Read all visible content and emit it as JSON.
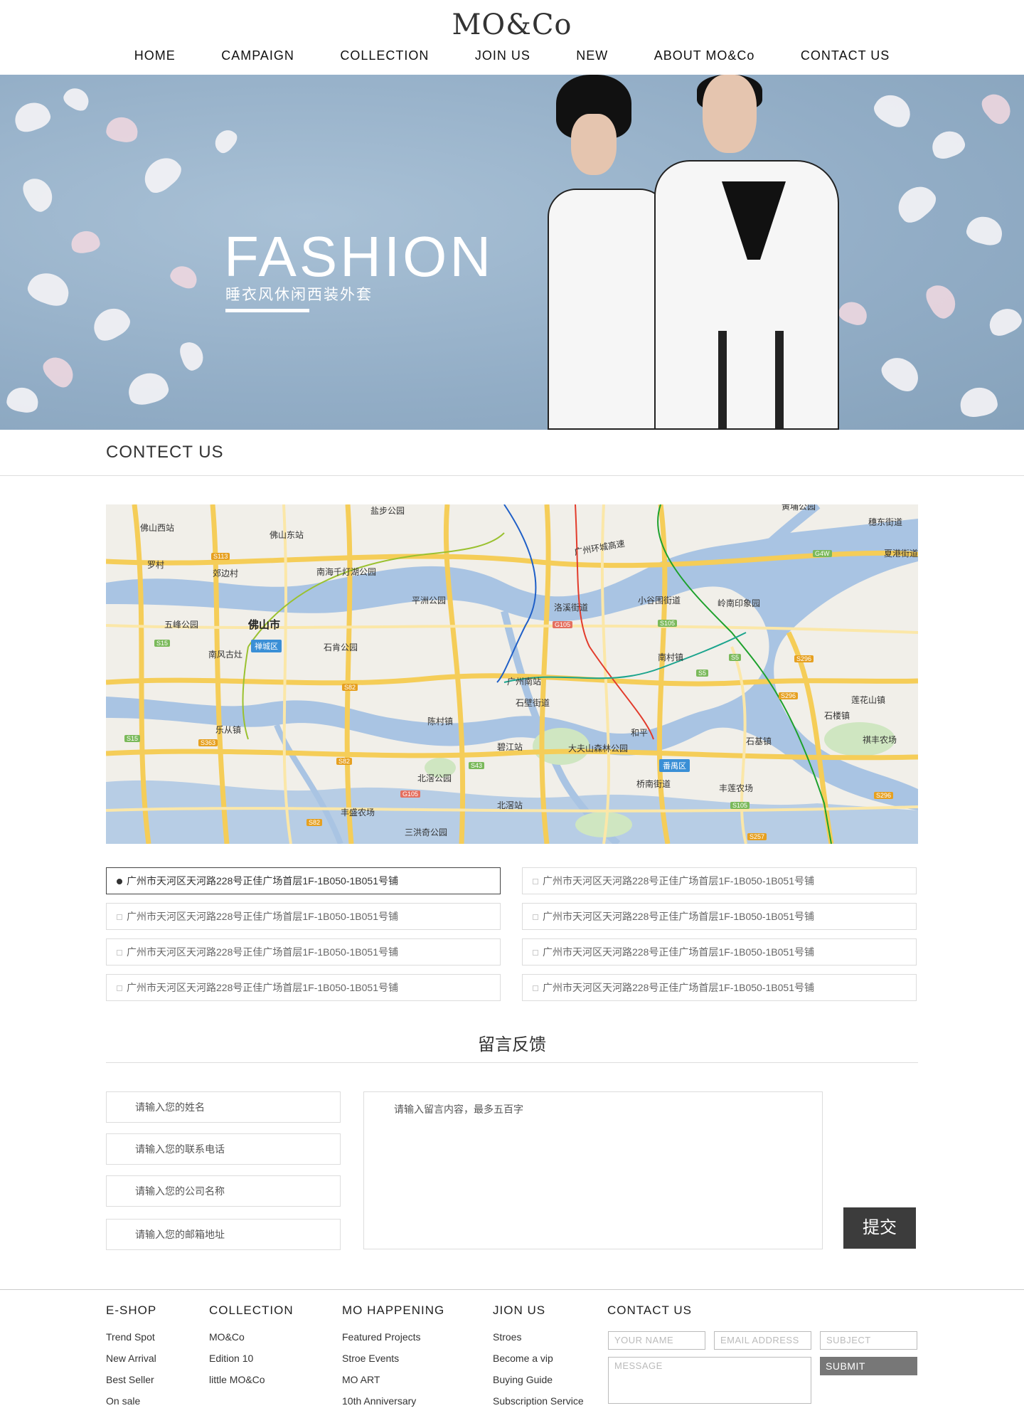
{
  "brand": {
    "logo": "MO&Co"
  },
  "nav": [
    {
      "label": "HOME"
    },
    {
      "label": "CAMPAIGN"
    },
    {
      "label": "COLLECTION"
    },
    {
      "label": "JOIN US"
    },
    {
      "label": "NEW"
    },
    {
      "label": "ABOUT MO&Co"
    },
    {
      "label": "CONTACT US"
    }
  ],
  "banner": {
    "title": "FASHION",
    "subtitle": "睡衣风休闲西装外套"
  },
  "contact_section": {
    "title": "CONTECT US"
  },
  "map": {
    "labels": {
      "foshan_west": "佛山西站",
      "foshan_east": "佛山东站",
      "yanbu_park": "盐步公园",
      "luocun": "罗村",
      "jiaobian": "郊边村",
      "nanhai_park": "南海千灯湖公园",
      "pingzhou_park": "平洲公园",
      "wufeng_park": "五峰公园",
      "foshan_city": "佛山市",
      "chancheng": "禅城区",
      "nanfeng": "南风古灶",
      "shiken_park": "石肯公园",
      "huanbao_highway": "广州环城高速",
      "luoxi": "洛溪街道",
      "xiaoguwei": "小谷围街道",
      "lingnan": "岭南印象园",
      "nancun": "南村镇",
      "guangzhou_south": "广州南站",
      "shibi": "石壁街道",
      "chencun": "陈村镇",
      "lecong": "乐从镇",
      "bijiang": "碧江站",
      "dafushan": "大夫山森林公园",
      "heping": "和平",
      "panyu": "番禺区",
      "qiaonan": "桥南街道",
      "beijiao_park": "北滘公园",
      "beijiao_station": "北滘站",
      "fengfeng": "丰盛农场",
      "sanhongqi": "三洪奇公园",
      "shiji": "石基镇",
      "fenglong": "丰莲农场",
      "lianhuashan": "莲花山镇",
      "shilou": "石楼镇",
      "qifeng": "祺丰农场",
      "dongyong": "穗东街道",
      "xiagang": "夏港街道",
      "tangbu": "黄埔公园"
    },
    "road_tags": [
      "S113",
      "S15",
      "S82",
      "S363",
      "S82",
      "S82",
      "S43",
      "G105",
      "G105",
      "S105",
      "S5",
      "S5",
      "S296",
      "S296",
      "S105",
      "S296",
      "G4W",
      "S15",
      "S257"
    ]
  },
  "stores": [
    "广州市天河区天河路228号正佳广场首层1F-1B050-1B051号铺",
    "广州市天河区天河路228号正佳广场首层1F-1B050-1B051号铺",
    "广州市天河区天河路228号正佳广场首层1F-1B050-1B051号铺",
    "广州市天河区天河路228号正佳广场首层1F-1B050-1B051号铺",
    "广州市天河区天河路228号正佳广场首层1F-1B050-1B051号铺",
    "广州市天河区天河路228号正佳广场首层1F-1B050-1B051号铺",
    "广州市天河区天河路228号正佳广场首层1F-1B050-1B051号铺",
    "广州市天河区天河路228号正佳广场首层1F-1B050-1B051号铺"
  ],
  "feedback": {
    "title": "留言反馈",
    "name_placeholder": "请输入您的姓名",
    "phone_placeholder": "请输入您的联系电话",
    "company_placeholder": "请输入您的公司名称",
    "email_placeholder": "请输入您的邮箱地址",
    "message_placeholder": "请输入留言内容，最多五百字",
    "submit_label": "提交"
  },
  "footer": {
    "eshop": {
      "title": "E-SHOP",
      "links": [
        "Trend Spot",
        "New Arrival",
        "Best Seller",
        "On sale"
      ]
    },
    "collection": {
      "title": "COLLECTION",
      "links": [
        "MO&Co",
        "Edition 10",
        "little MO&Co"
      ]
    },
    "happening": {
      "title": "MO HAPPENING",
      "links": [
        "Featured Projects",
        "Stroe Events",
        "MO ART",
        "10th Anniversary"
      ]
    },
    "join": {
      "title": "JION US",
      "links": [
        "Stroes",
        "Become a vip",
        "Buying Guide",
        "Subscription Service"
      ]
    },
    "contact": {
      "title": "CONTACT US",
      "name_placeholder": "YOUR NAME",
      "email_placeholder": "EMAIL ADDRESS",
      "subject_placeholder": "SUBJECT",
      "message_placeholder": "MESSAGE",
      "submit_label": "SUBMIT"
    }
  }
}
